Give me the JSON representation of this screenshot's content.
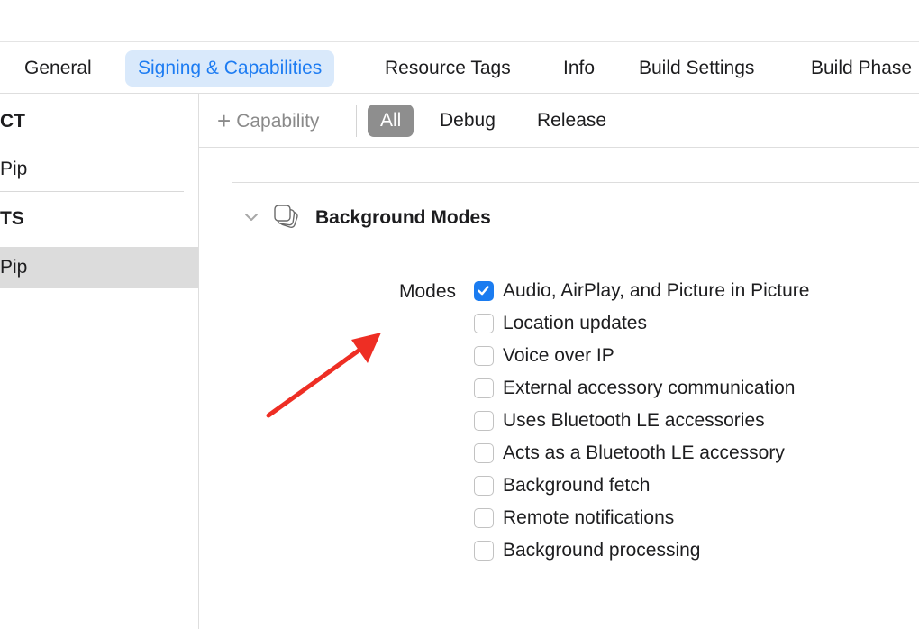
{
  "tabs": [
    {
      "label": "General",
      "active": false
    },
    {
      "label": "Signing & Capabilities",
      "active": true
    },
    {
      "label": "Resource Tags",
      "active": false
    },
    {
      "label": "Info",
      "active": false
    },
    {
      "label": "Build Settings",
      "active": false
    },
    {
      "label": "Build Phase",
      "active": false
    }
  ],
  "sidebar": {
    "project_header": "CT",
    "project_item": "Pip",
    "targets_header": "TS",
    "target_item": "Pip"
  },
  "toolbar": {
    "add_capability": "Capability",
    "filters": [
      "All",
      "Debug",
      "Release"
    ],
    "active_filter": "All"
  },
  "capability": {
    "title": "Background Modes",
    "modes_label": "Modes",
    "modes": [
      {
        "label": "Audio, AirPlay, and Picture in Picture",
        "checked": true
      },
      {
        "label": "Location updates",
        "checked": false
      },
      {
        "label": "Voice over IP",
        "checked": false
      },
      {
        "label": "External accessory communication",
        "checked": false
      },
      {
        "label": "Uses Bluetooth LE accessories",
        "checked": false
      },
      {
        "label": "Acts as a Bluetooth LE accessory",
        "checked": false
      },
      {
        "label": "Background fetch",
        "checked": false
      },
      {
        "label": "Remote notifications",
        "checked": false
      },
      {
        "label": "Background processing",
        "checked": false
      }
    ]
  },
  "colors": {
    "accent": "#1b7cf0",
    "active_tab_bg": "#d9e9fb",
    "annotation_arrow": "#ee2e24"
  }
}
